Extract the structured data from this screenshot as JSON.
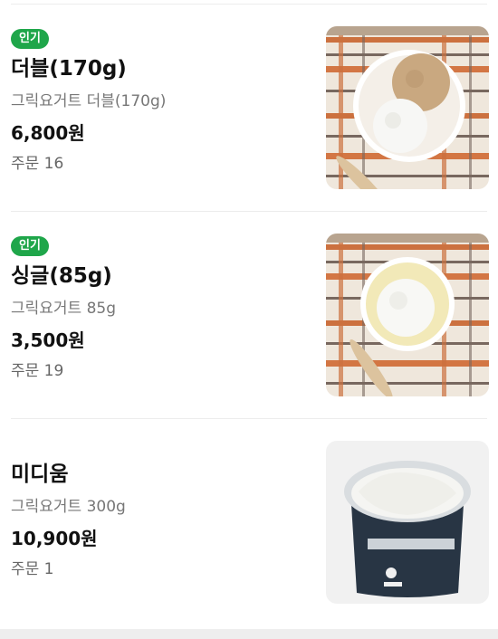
{
  "menu": {
    "items": [
      {
        "badge": "인기",
        "name": "더블(170g)",
        "description": "그릭요거트 더블(170g)",
        "price": "6,800원",
        "orders_label": "주문 16",
        "image": "double-scoop-greek-yogurt-photo"
      },
      {
        "badge": "인기",
        "name": "싱글(85g)",
        "description": "그릭요거트 85g",
        "price": "3,500원",
        "orders_label": "주문 19",
        "image": "single-scoop-greek-yogurt-photo"
      },
      {
        "badge": "",
        "name": "미디움",
        "description": "그릭요거트 300g",
        "price": "10,900원",
        "orders_label": "주문 1",
        "image": "greek-yogurt-tub-photo"
      }
    ]
  },
  "colors": {
    "popular_badge": "#1fa64a",
    "divider": "#ececec"
  }
}
